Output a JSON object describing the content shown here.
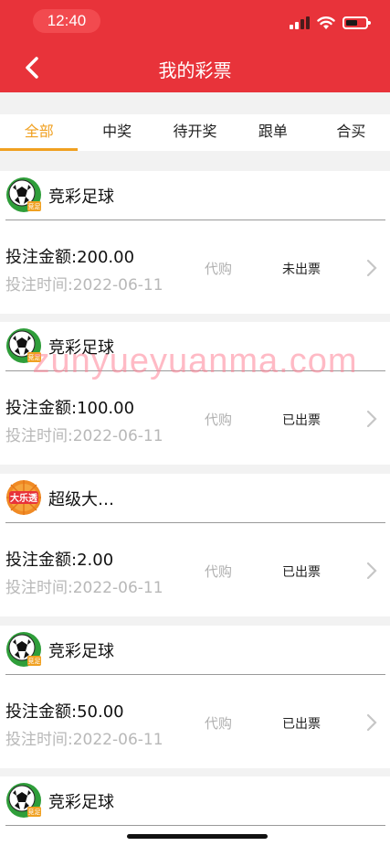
{
  "status_bar": {
    "time": "12:40"
  },
  "header": {
    "title": "我的彩票"
  },
  "tabs": [
    {
      "label": "全部",
      "active": true
    },
    {
      "label": "中奖",
      "active": false
    },
    {
      "label": "待开奖",
      "active": false
    },
    {
      "label": "跟单",
      "active": false
    },
    {
      "label": "合买",
      "active": false
    }
  ],
  "orders": [
    {
      "lottery": "竞彩足球",
      "logo": "soccer-ball-icon",
      "amount": "投注金额:200.00",
      "time": "投注时间:2022-06-11",
      "type": "代购",
      "status": "未出票"
    },
    {
      "lottery": "竞彩足球",
      "logo": "soccer-ball-icon",
      "amount": "投注金额:100.00",
      "time": "投注时间:2022-06-11",
      "type": "代购",
      "status": "已出票"
    },
    {
      "lottery": "超级大…",
      "logo": "daletou-logo-icon",
      "amount": "投注金额:2.00",
      "time": "投注时间:2022-06-11",
      "type": "代购",
      "status": "已出票"
    },
    {
      "lottery": "竞彩足球",
      "logo": "soccer-ball-icon",
      "amount": "投注金额:50.00",
      "time": "投注时间:2022-06-11",
      "type": "代购",
      "status": "已出票"
    },
    {
      "lottery": "竞彩足球",
      "logo": "soccer-ball-icon"
    }
  ],
  "watermark": "zunyueyuanma.com",
  "colors": {
    "header": "#e8333a",
    "active_tab": "#f0a020"
  }
}
